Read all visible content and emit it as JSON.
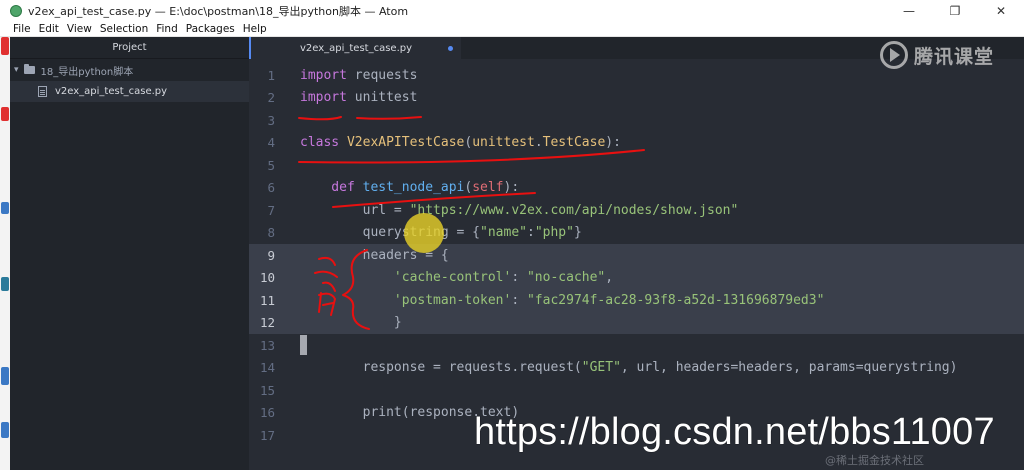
{
  "window": {
    "title": "v2ex_api_test_case.py — E:\\doc\\postman\\18_导出python脚本 — Atom",
    "minimize": "—",
    "maximize": "❐",
    "close": "✕"
  },
  "menu": [
    "File",
    "Edit",
    "View",
    "Selection",
    "Find",
    "Packages",
    "Help"
  ],
  "tree": {
    "header": "Project",
    "folder": "18_导出python脚本",
    "file": "v2ex_api_test_case.py"
  },
  "tab": {
    "label": "v2ex_api_test_case.py",
    "modified": true
  },
  "watermarks": {
    "logo": "腾讯课堂",
    "blog": "https://blog.csdn.net/bbs11007",
    "community": "@稀土掘金技术社区"
  },
  "code_lines": [
    {
      "num": "1",
      "highlight": false,
      "tokens": [
        {
          "t": "import",
          "c": "t-kw"
        },
        {
          "t": " requests",
          "c": "t-plain"
        }
      ]
    },
    {
      "num": "2",
      "highlight": false,
      "tokens": [
        {
          "t": "import",
          "c": "t-kw"
        },
        {
          "t": " unittest",
          "c": "t-plain"
        }
      ]
    },
    {
      "num": "3",
      "highlight": false,
      "tokens": []
    },
    {
      "num": "4",
      "highlight": false,
      "tokens": [
        {
          "t": "class ",
          "c": "t-kw"
        },
        {
          "t": "V2exAPITestCase",
          "c": "t-cls"
        },
        {
          "t": "(",
          "c": "t-plain"
        },
        {
          "t": "unittest",
          "c": "t-cls"
        },
        {
          "t": ".",
          "c": "t-plain"
        },
        {
          "t": "TestCase",
          "c": "t-cls"
        },
        {
          "t": "):",
          "c": "t-plain"
        }
      ]
    },
    {
      "num": "5",
      "highlight": false,
      "tokens": []
    },
    {
      "num": "6",
      "highlight": false,
      "tokens": [
        {
          "t": "    def ",
          "c": "t-kw"
        },
        {
          "t": "test_node_api",
          "c": "t-fn"
        },
        {
          "t": "(",
          "c": "t-plain"
        },
        {
          "t": "self",
          "c": "t-self"
        },
        {
          "t": "):",
          "c": "t-plain"
        }
      ]
    },
    {
      "num": "7",
      "highlight": false,
      "tokens": [
        {
          "t": "        url = ",
          "c": "t-plain"
        },
        {
          "t": "\"https://www.v2ex.com/api/nodes/show.json\"",
          "c": "t-str"
        }
      ]
    },
    {
      "num": "8",
      "highlight": false,
      "tokens": [
        {
          "t": "        querystring = {",
          "c": "t-plain"
        },
        {
          "t": "\"name\"",
          "c": "t-str"
        },
        {
          "t": ":",
          "c": "t-plain"
        },
        {
          "t": "\"php\"",
          "c": "t-str"
        },
        {
          "t": "}",
          "c": "t-plain"
        }
      ]
    },
    {
      "num": "9",
      "highlight": true,
      "tokens": [
        {
          "t": "        headers = {",
          "c": "t-plain"
        }
      ]
    },
    {
      "num": "10",
      "highlight": true,
      "tokens": [
        {
          "t": "            ",
          "c": "t-plain"
        },
        {
          "t": "'cache-control'",
          "c": "t-str"
        },
        {
          "t": ": ",
          "c": "t-plain"
        },
        {
          "t": "\"no-cache\"",
          "c": "t-str"
        },
        {
          "t": ",",
          "c": "t-plain"
        }
      ]
    },
    {
      "num": "11",
      "highlight": true,
      "tokens": [
        {
          "t": "            ",
          "c": "t-plain"
        },
        {
          "t": "'postman-token'",
          "c": "t-str"
        },
        {
          "t": ": ",
          "c": "t-plain"
        },
        {
          "t": "\"fac2974f-ac28-93f8-a52d-131696879ed3\"",
          "c": "t-str"
        }
      ]
    },
    {
      "num": "12",
      "highlight": true,
      "tokens": [
        {
          "t": "            }",
          "c": "t-plain"
        }
      ]
    },
    {
      "num": "13",
      "highlight": false,
      "cursor": true,
      "tokens": []
    },
    {
      "num": "14",
      "highlight": false,
      "tokens": [
        {
          "t": "        response = requests.request(",
          "c": "t-plain"
        },
        {
          "t": "\"GET\"",
          "c": "t-str"
        },
        {
          "t": ", url, headers=headers, params=querystring)",
          "c": "t-plain"
        }
      ]
    },
    {
      "num": "15",
      "highlight": false,
      "tokens": []
    },
    {
      "num": "16",
      "highlight": false,
      "tokens": [
        {
          "t": "        print",
          "c": "t-plain"
        },
        {
          "t": "(response.text)",
          "c": "t-plain"
        }
      ]
    },
    {
      "num": "17",
      "highlight": false,
      "tokens": []
    }
  ],
  "colors": {
    "editor_bg": "#282c34",
    "sidebar_bg": "#21252b",
    "annotation_red": "#e81010",
    "keyword": "#c678dd",
    "string": "#98c379"
  }
}
